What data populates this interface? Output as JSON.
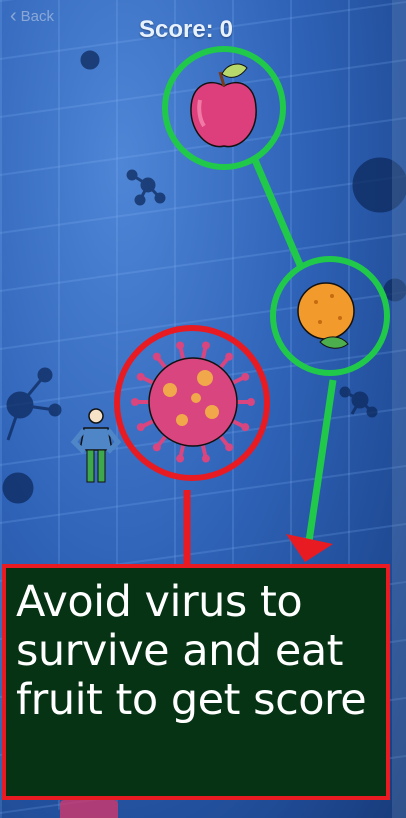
{
  "nav": {
    "back_label": "Back",
    "back_icon": "chevron-left-icon"
  },
  "hud": {
    "score_label": "Score:",
    "score_value": "0"
  },
  "tutorial": {
    "message": "Avoid virus to survive and eat fruit to get score",
    "highlight_colors": {
      "good": "#21c94a",
      "bad": "#e81b23"
    }
  },
  "game_objects": [
    {
      "kind": "fruit",
      "name": "apple",
      "icon": "apple-icon"
    },
    {
      "kind": "fruit",
      "name": "orange",
      "icon": "orange-icon"
    },
    {
      "kind": "hazard",
      "name": "virus",
      "icon": "virus-icon"
    },
    {
      "kind": "player",
      "name": "player",
      "icon": "player-character-icon"
    }
  ]
}
